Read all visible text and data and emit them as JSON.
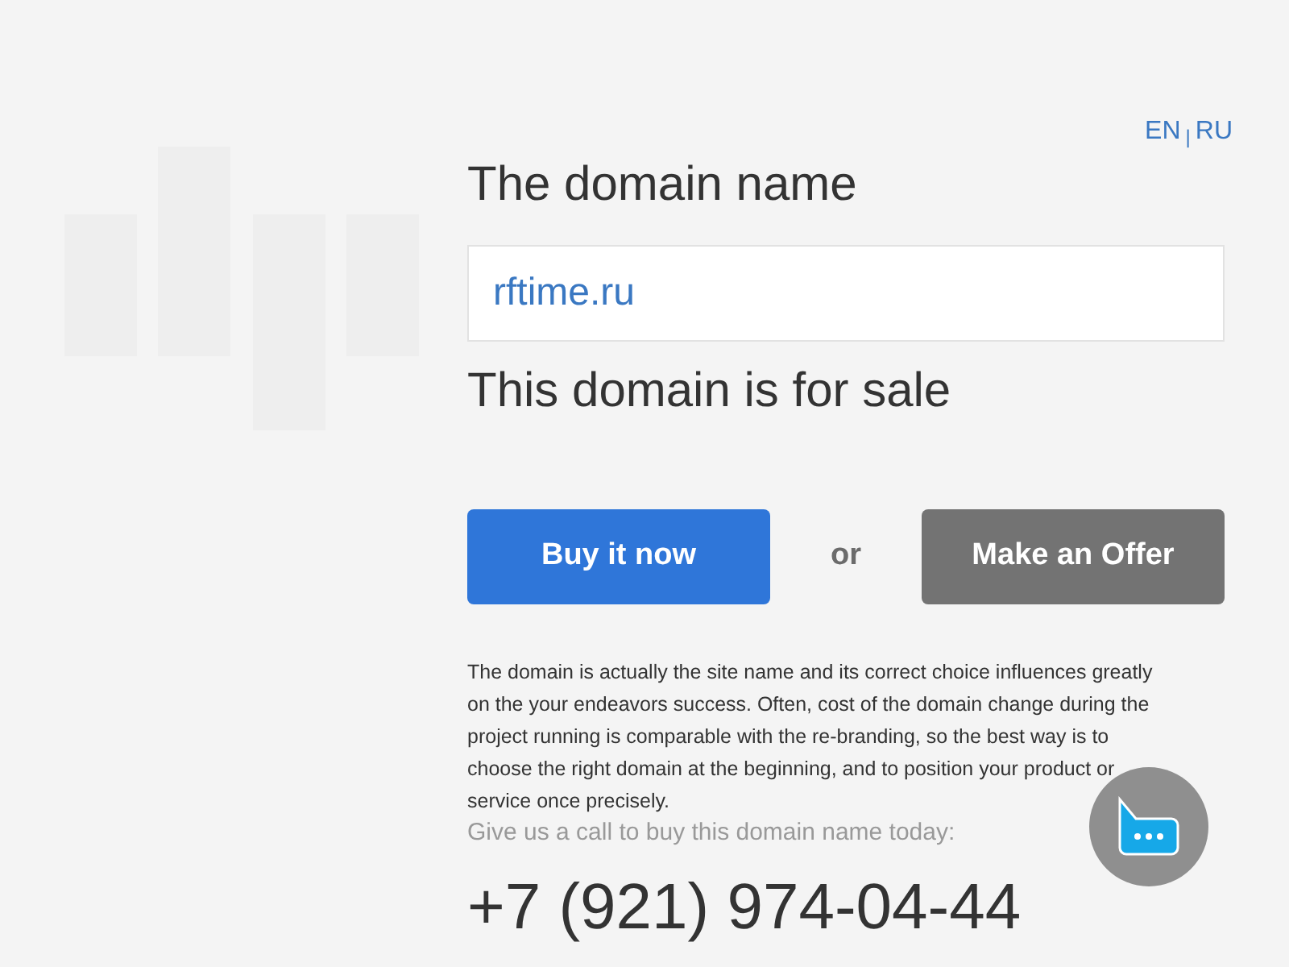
{
  "languages": [
    "EN",
    "|",
    "RU"
  ],
  "heading": "The domain name",
  "domain_field": {
    "value": "rftime.ru"
  },
  "sale_text": "This domain is for sale",
  "buttons": [
    {
      "label": "Buy it now",
      "kind": "primary"
    },
    {
      "label": "or",
      "kind": "separator"
    },
    {
      "label": "Make an Offer",
      "kind": "secondary"
    }
  ],
  "description": "The domain is actually the site name and its correct choice influences greatly on the your endeavors success. Often, cost of the domain change during the project running is comparable with the re-branding, so the best way is to choose the right domain at the beginning, and to position your product or service once precisely.",
  "call_text": "Give us a call to buy this domain name today:",
  "phone": "+7 (921) 974-04-44"
}
